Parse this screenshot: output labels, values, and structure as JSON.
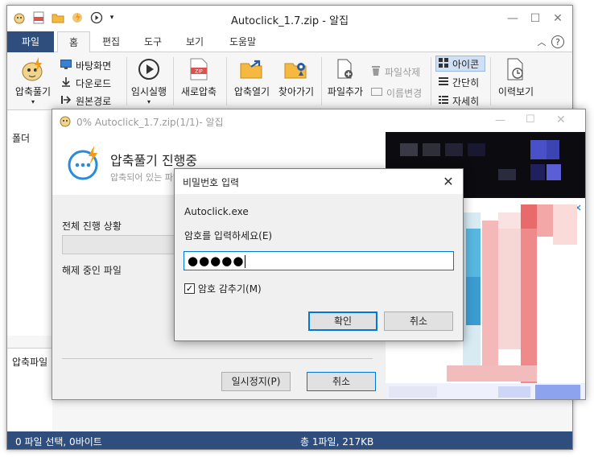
{
  "app": {
    "title": "Autoclick_1.7.zip - 알집",
    "tabs": [
      "파일",
      "홈",
      "편집",
      "도구",
      "보기",
      "도움말"
    ]
  },
  "ribbon": {
    "extract": "압축풀기",
    "desktop": "바탕화면",
    "downloads": "다운로드",
    "original_path": "원본경로",
    "test_run": "임시실행",
    "new_archive": "새로압축",
    "open_archive": "압축열기",
    "find": "찾아가기",
    "add_file": "파일추가",
    "delete_file": "파일삭제",
    "rename": "이름변경",
    "view_icon": "아이콘",
    "view_simple": "간단히",
    "view_detail": "자세히",
    "history": "이력보기"
  },
  "left_pane": {
    "folder": "폴더",
    "bottom": "압축파일"
  },
  "statusbar": {
    "left": "0 파일 선택, 0바이트",
    "right": "총 1파일, 217KB"
  },
  "progress_dialog": {
    "title": "0% Autoclick_1.7.zip(1/1)- 알집",
    "heading": "압축풀기 진행중",
    "subheading": "압축되어 있는 파일",
    "overall_label": "전체 진행 상황",
    "current_label": "해제 중인 파일",
    "pause_button": "일시정지(P)",
    "cancel_button": "취소",
    "progress": 0
  },
  "password_dialog": {
    "title": "비밀번호 입력",
    "filename": "Autoclick.exe",
    "prompt": "암호를 입력하세요(E)",
    "masked_value": "●●●●●",
    "hide_checkbox": "암호 감추기(M)",
    "hide_checked": true,
    "ok_button": "확인",
    "cancel_button": "취소"
  },
  "colors": {
    "accent": "#2f4e7e",
    "focus": "#0078d7"
  }
}
